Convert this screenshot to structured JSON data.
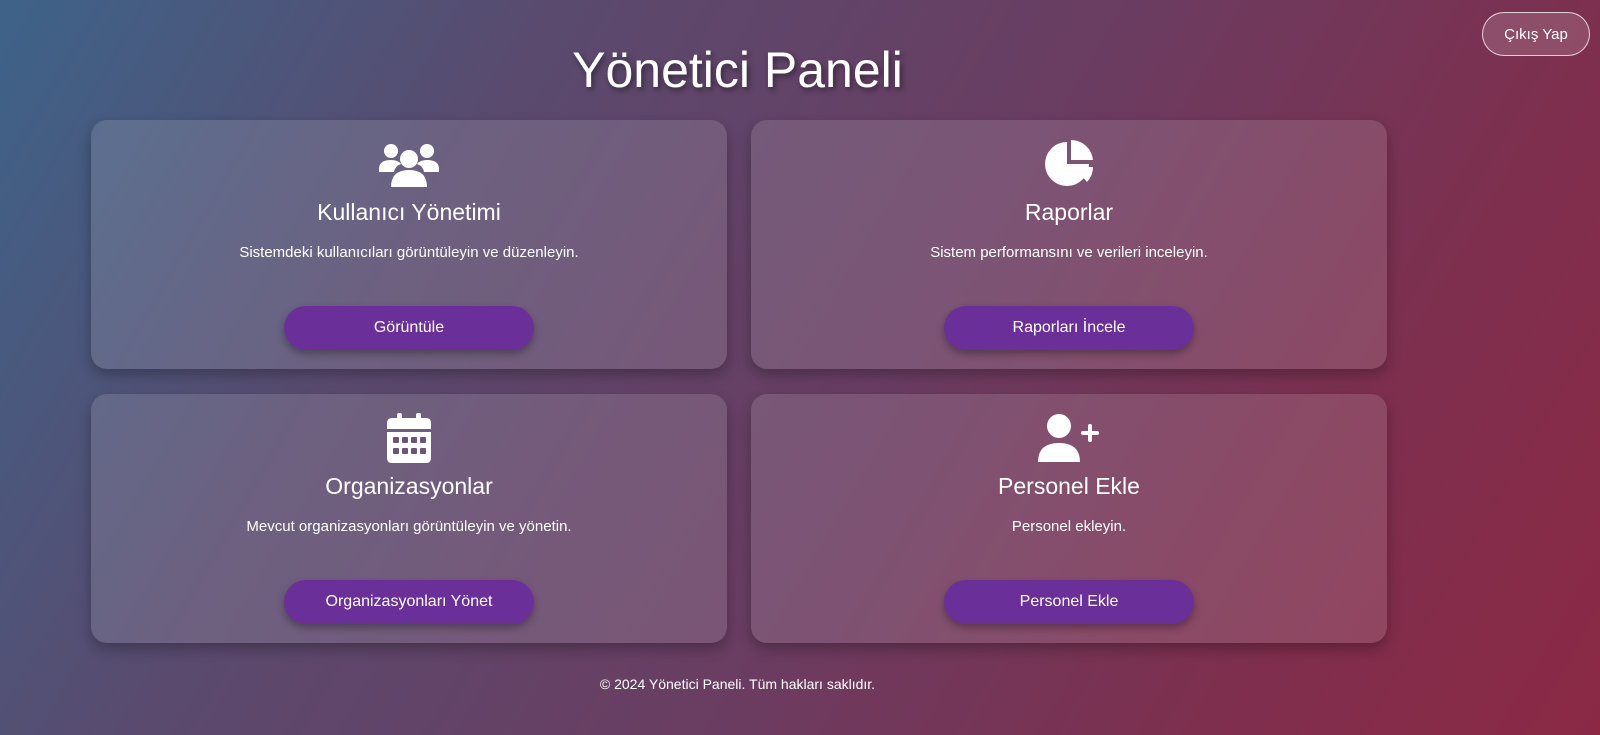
{
  "header": {
    "title": "Yönetici Paneli",
    "logout_label": "Çıkış Yap"
  },
  "cards": [
    {
      "icon": "users-icon",
      "title": "Kullanıcı Yönetimi",
      "description": "Sistemdeki kullanıcıları görüntüleyin ve düzenleyin.",
      "button_label": "Görüntüle"
    },
    {
      "icon": "pie-chart-icon",
      "title": "Raporlar",
      "description": "Sistem performansını ve verileri inceleyin.",
      "button_label": "Raporları İncele"
    },
    {
      "icon": "calendar-icon",
      "title": "Organizasyonlar",
      "description": "Mevcut organizasyonları görüntüleyin ve yönetin.",
      "button_label": "Organizasyonları Yönet"
    },
    {
      "icon": "user-plus-icon",
      "title": "Personel Ekle",
      "description": "Personel ekleyin.",
      "button_label": "Personel Ekle"
    }
  ],
  "footer": {
    "text": "© 2024 Yönetici Paneli. Tüm hakları saklıdır."
  },
  "colors": {
    "button": "#6b2f99",
    "gradient_start": "#3e6389",
    "gradient_end": "#8b2945"
  }
}
